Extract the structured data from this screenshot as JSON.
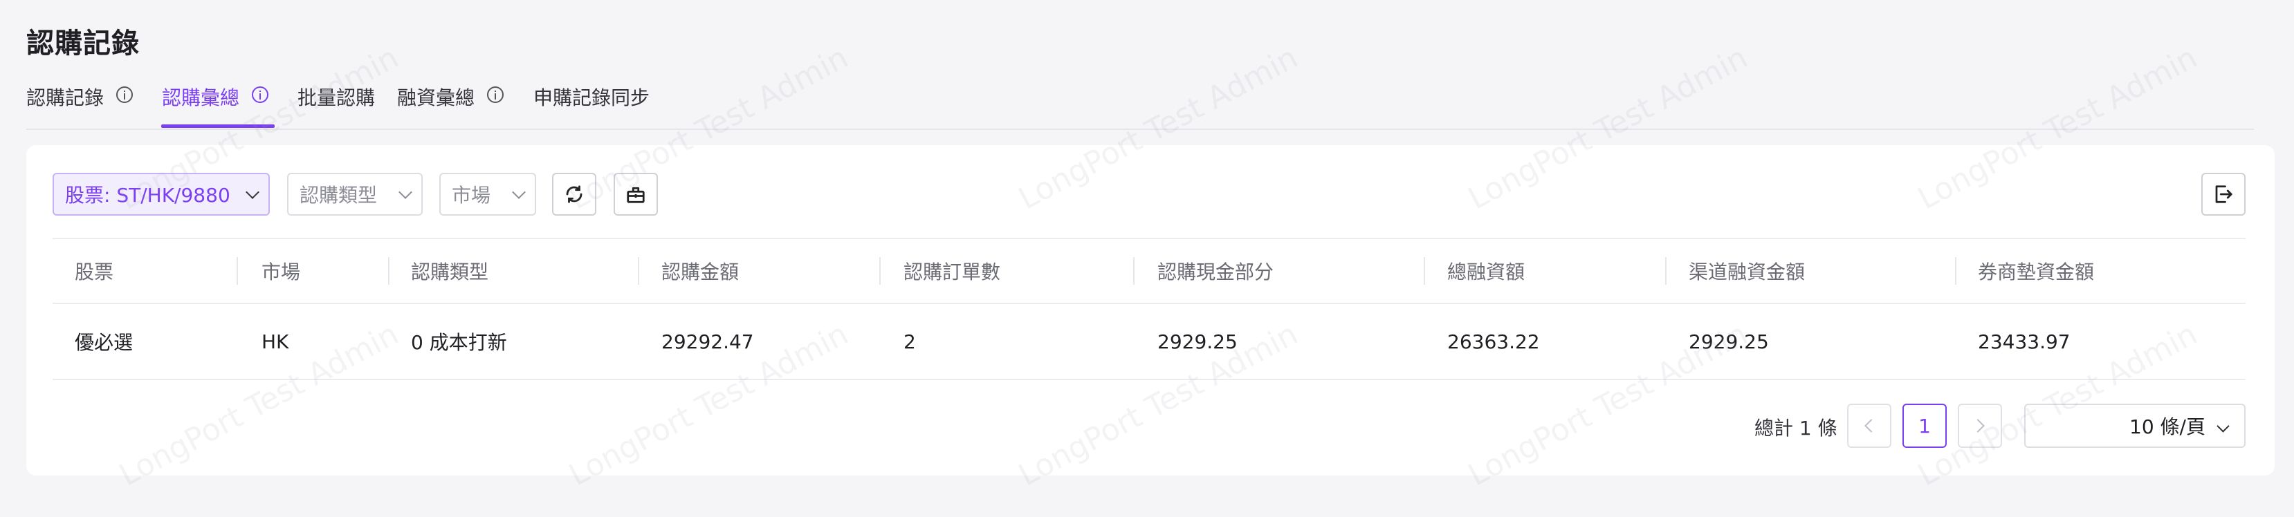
{
  "page": {
    "title": "認購記錄"
  },
  "tabs": [
    {
      "label": "認購記錄",
      "has_info": true,
      "active": false
    },
    {
      "label": "認購彙總",
      "has_info": true,
      "active": true
    },
    {
      "label": "批量認購",
      "has_info": false,
      "active": false
    },
    {
      "label": "融資彙總",
      "has_info": true,
      "active": false
    },
    {
      "label": "申購記錄同步",
      "has_info": false,
      "active": false
    }
  ],
  "filters": {
    "stock": {
      "value": "股票: ST/HK/9880"
    },
    "subscription_type": {
      "placeholder": "認購類型"
    },
    "market": {
      "placeholder": "市場"
    },
    "refresh_icon": "refresh-icon",
    "clear_icon": "clear-icon",
    "export_icon": "export-icon"
  },
  "table": {
    "columns": [
      "股票",
      "市場",
      "認購類型",
      "認購金額",
      "認購訂單數",
      "認購現金部分",
      "總融資額",
      "渠道融資金額",
      "券商墊資金額"
    ],
    "rows": [
      [
        "優必選",
        "HK",
        "0 成本打新",
        "29292.47",
        "2",
        "2929.25",
        "26363.22",
        "2929.25",
        "23433.97"
      ]
    ]
  },
  "pagination": {
    "total_label": "總計 1 條",
    "current_page": "1",
    "page_size_label": "10 條/頁"
  },
  "watermark": {
    "text": "LongPort Test Admin"
  },
  "colors": {
    "accent": "#7b3ff2",
    "background": "#f5f5f7",
    "card": "#ffffff"
  }
}
